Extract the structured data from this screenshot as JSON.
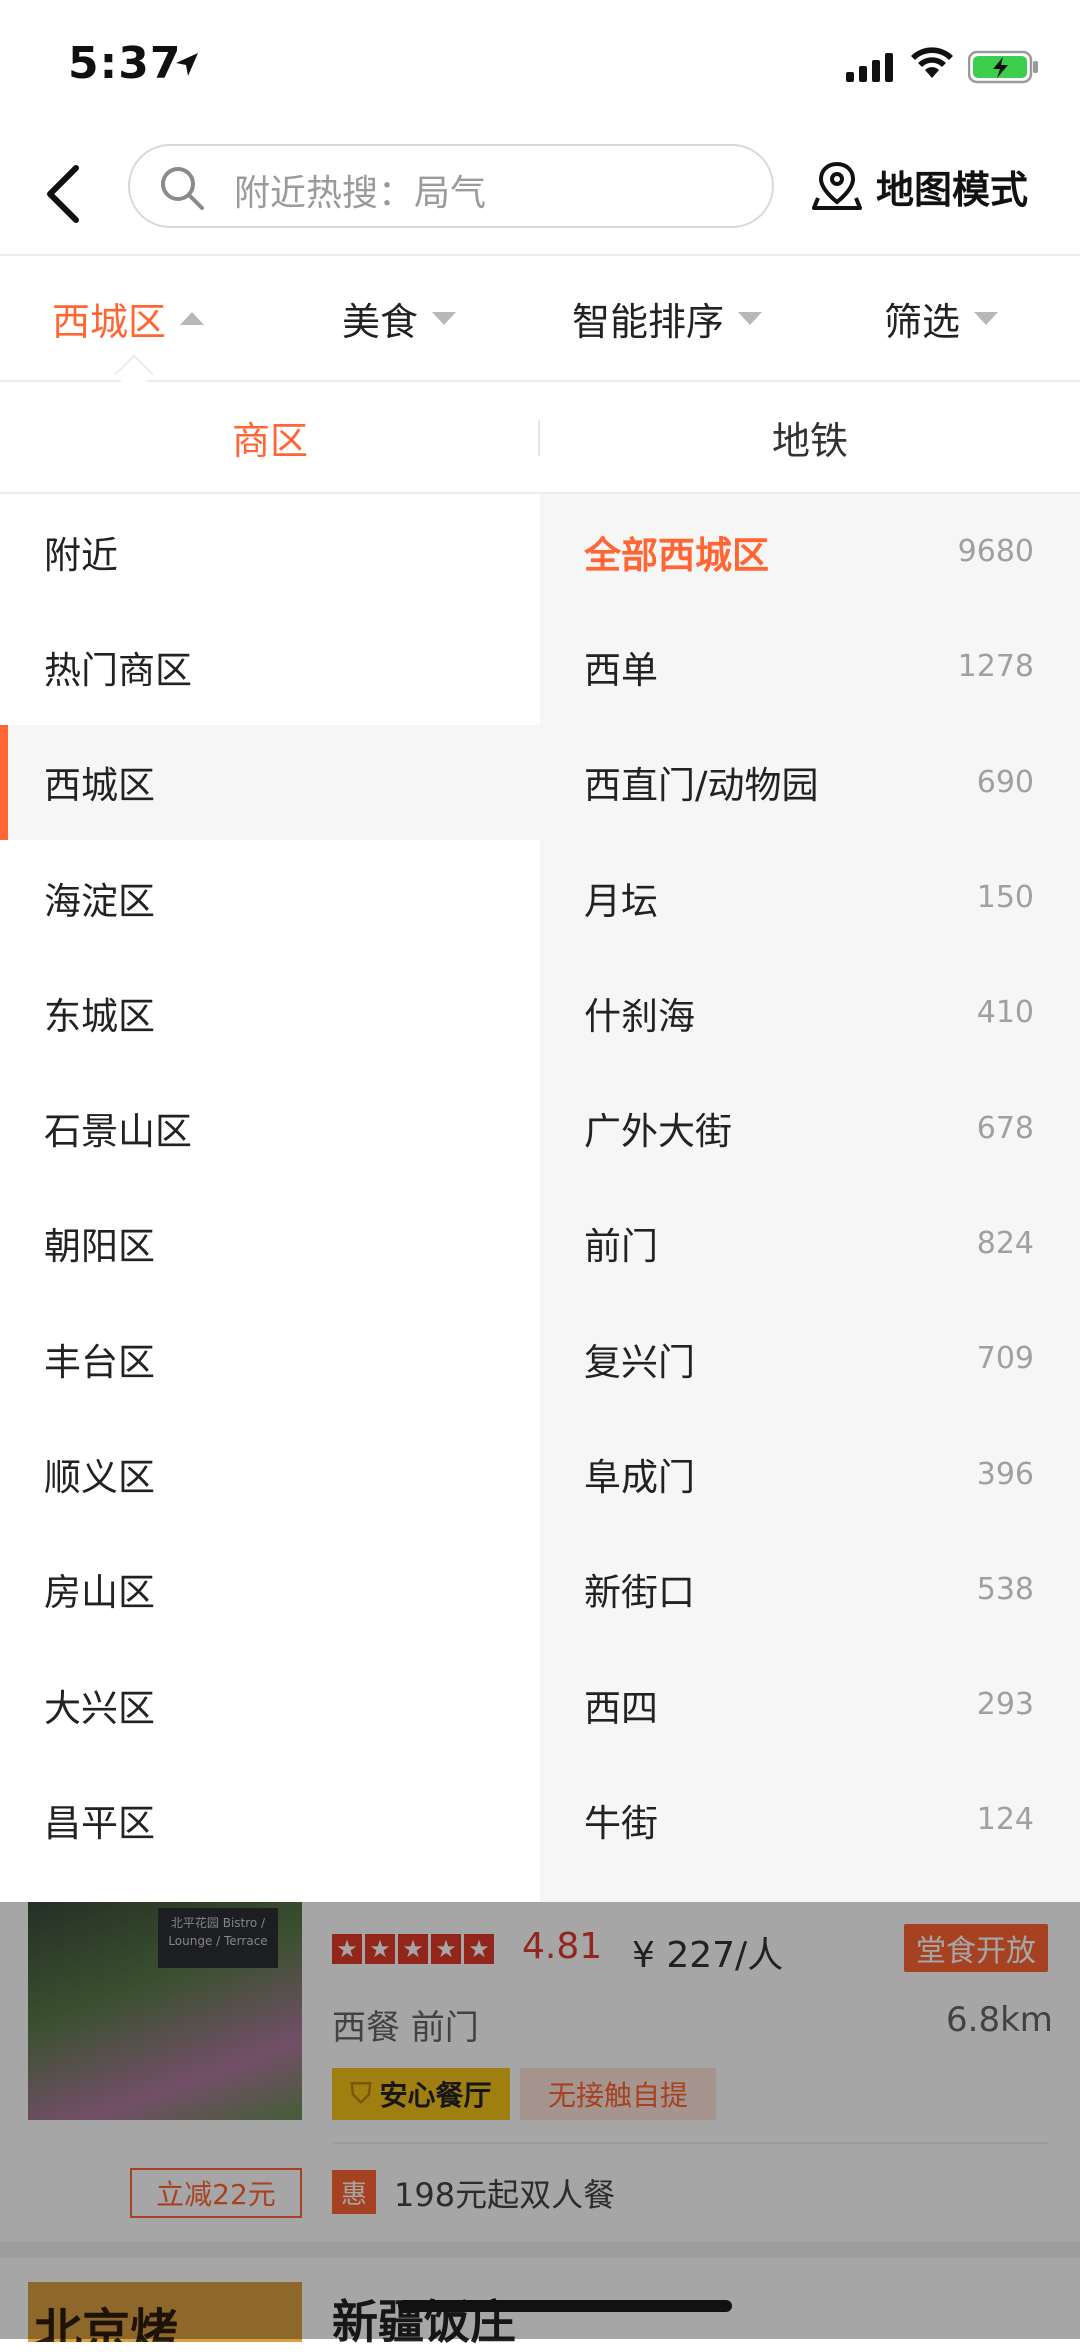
{
  "status_bar": {
    "time": "5:37"
  },
  "header": {
    "search_placeholder": "附近热搜：局气",
    "map_mode": "地图模式"
  },
  "filters": [
    {
      "label": "西城区",
      "active": true
    },
    {
      "label": "美食",
      "active": false
    },
    {
      "label": "智能排序",
      "active": false
    },
    {
      "label": "筛选",
      "active": false
    }
  ],
  "subtabs": {
    "business": "商区",
    "subway": "地铁"
  },
  "districts": [
    "附近",
    "热门商区",
    "西城区",
    "海淀区",
    "东城区",
    "石景山区",
    "朝阳区",
    "丰台区",
    "顺义区",
    "房山区",
    "大兴区",
    "昌平区"
  ],
  "selected_district_index": 2,
  "areas": [
    {
      "name": "全部西城区",
      "count": "9680"
    },
    {
      "name": "西单",
      "count": "1278"
    },
    {
      "name": "西直门/动物园",
      "count": "690"
    },
    {
      "name": "月坛",
      "count": "150"
    },
    {
      "name": "什刹海",
      "count": "410"
    },
    {
      "name": "广外大街",
      "count": "678"
    },
    {
      "name": "前门",
      "count": "824"
    },
    {
      "name": "复兴门",
      "count": "709"
    },
    {
      "name": "阜成门",
      "count": "396"
    },
    {
      "name": "新街口",
      "count": "538"
    },
    {
      "name": "西四",
      "count": "293"
    },
    {
      "name": "牛街",
      "count": "124"
    }
  ],
  "listing": {
    "sign_text": "北平花园 Bistro / Lounge / Terrace",
    "stars": 5,
    "rating": "4.81",
    "price": "¥ 227/人",
    "open_badge": "堂食开放",
    "category": "西餐",
    "area": "前门",
    "distance": "6.8km",
    "safe_badge": "安心餐厅",
    "contact_badge": "无接触自提",
    "promo": "立减22元",
    "hui": "惠",
    "deal": "198元起双人餐",
    "next_thumb_text": "北京烤",
    "next_name": "新疆饭庄"
  },
  "colors": {
    "accent": "#ff6633",
    "star": "#e03b2a"
  }
}
